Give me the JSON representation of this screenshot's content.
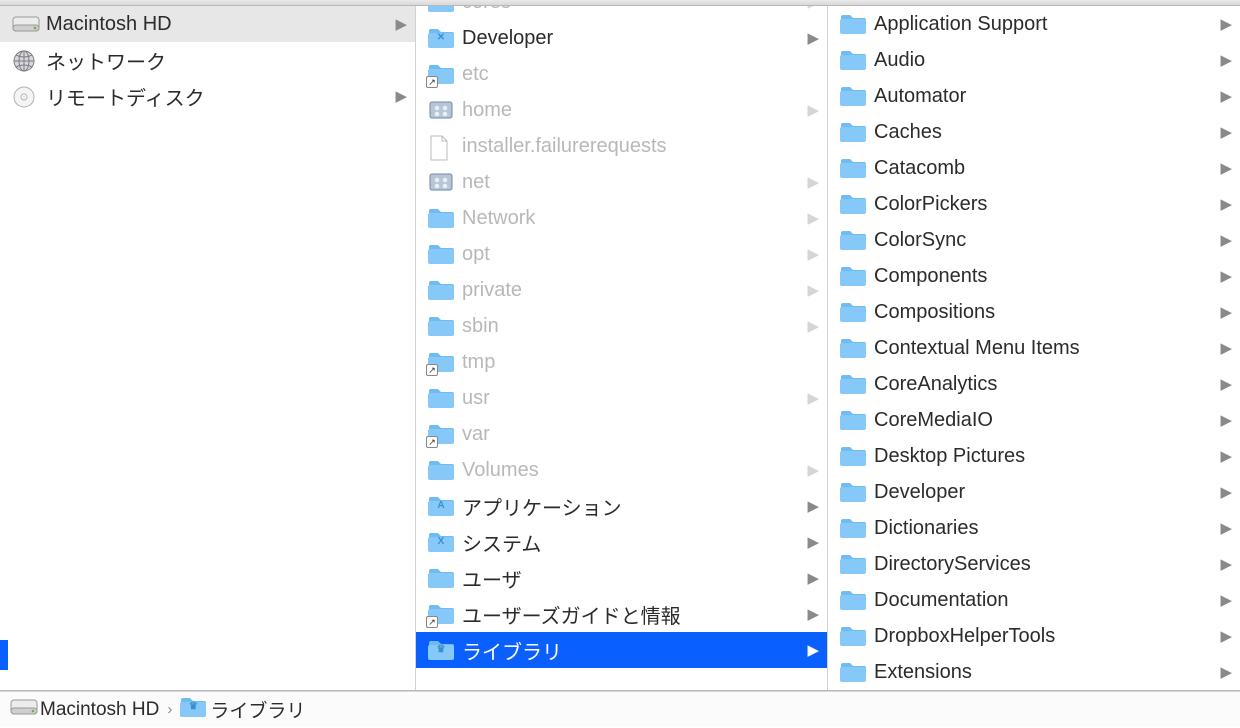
{
  "columns": {
    "devices": [
      {
        "id": "hd",
        "label": "Macintosh HD",
        "icon": "hdd",
        "arrow": true,
        "selected": true
      },
      {
        "id": "network",
        "label": "ネットワーク",
        "icon": "globe",
        "arrow": false,
        "selected": false
      },
      {
        "id": "remote",
        "label": "リモートディスク",
        "icon": "cd",
        "arrow": true,
        "selected": false
      }
    ],
    "root": [
      {
        "label": "cores",
        "icon": "folder",
        "dim": true,
        "arrow": true,
        "alias": false
      },
      {
        "label": "Developer",
        "icon": "folder-dev",
        "dim": false,
        "arrow": true,
        "alias": false
      },
      {
        "label": "etc",
        "icon": "folder",
        "dim": true,
        "arrow": false,
        "alias": true
      },
      {
        "label": "home",
        "icon": "server",
        "dim": true,
        "arrow": true,
        "alias": false
      },
      {
        "label": "installer.failurerequests",
        "icon": "file",
        "dim": true,
        "arrow": false,
        "alias": false
      },
      {
        "label": "net",
        "icon": "server",
        "dim": true,
        "arrow": true,
        "alias": false
      },
      {
        "label": "Network",
        "icon": "folder",
        "dim": true,
        "arrow": true,
        "alias": false
      },
      {
        "label": "opt",
        "icon": "folder",
        "dim": true,
        "arrow": true,
        "alias": false
      },
      {
        "label": "private",
        "icon": "folder",
        "dim": true,
        "arrow": true,
        "alias": false
      },
      {
        "label": "sbin",
        "icon": "folder",
        "dim": true,
        "arrow": true,
        "alias": false
      },
      {
        "label": "tmp",
        "icon": "folder",
        "dim": true,
        "arrow": false,
        "alias": true
      },
      {
        "label": "usr",
        "icon": "folder",
        "dim": true,
        "arrow": true,
        "alias": false
      },
      {
        "label": "var",
        "icon": "folder",
        "dim": true,
        "arrow": false,
        "alias": true
      },
      {
        "label": "Volumes",
        "icon": "folder",
        "dim": true,
        "arrow": true,
        "alias": false
      },
      {
        "label": "アプリケーション",
        "icon": "folder-apps",
        "dim": false,
        "arrow": true,
        "alias": false
      },
      {
        "label": "システム",
        "icon": "folder-sys",
        "dim": false,
        "arrow": true,
        "alias": false
      },
      {
        "label": "ユーザ",
        "icon": "folder",
        "dim": false,
        "arrow": true,
        "alias": false
      },
      {
        "label": "ユーザーズガイドと情報",
        "icon": "folder",
        "dim": false,
        "arrow": true,
        "alias": true
      },
      {
        "label": "ライブラリ",
        "icon": "folder-lib",
        "dim": false,
        "arrow": true,
        "alias": false,
        "selected": true
      }
    ],
    "library": [
      {
        "label": "Application Support",
        "arrow": true
      },
      {
        "label": "Audio",
        "arrow": true
      },
      {
        "label": "Automator",
        "arrow": true
      },
      {
        "label": "Caches",
        "arrow": true
      },
      {
        "label": "Catacomb",
        "arrow": true
      },
      {
        "label": "ColorPickers",
        "arrow": true
      },
      {
        "label": "ColorSync",
        "arrow": true
      },
      {
        "label": "Components",
        "arrow": true
      },
      {
        "label": "Compositions",
        "arrow": true
      },
      {
        "label": "Contextual Menu Items",
        "arrow": true
      },
      {
        "label": "CoreAnalytics",
        "arrow": true
      },
      {
        "label": "CoreMediaIO",
        "arrow": true
      },
      {
        "label": "Desktop Pictures",
        "arrow": true
      },
      {
        "label": "Developer",
        "arrow": true
      },
      {
        "label": "Dictionaries",
        "arrow": true
      },
      {
        "label": "DirectoryServices",
        "arrow": true
      },
      {
        "label": "Documentation",
        "arrow": true
      },
      {
        "label": "DropboxHelperTools",
        "arrow": true
      },
      {
        "label": "Extensions",
        "arrow": true
      }
    ]
  },
  "pathbar": {
    "items": [
      {
        "label": "Macintosh HD",
        "icon": "hdd"
      },
      {
        "label": "ライブラリ",
        "icon": "folder-lib"
      }
    ]
  }
}
